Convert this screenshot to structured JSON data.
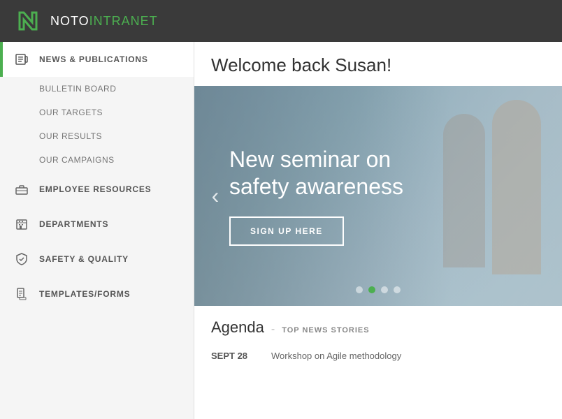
{
  "topbar": {
    "logo_text_part1": "NOTO",
    "logo_text_part2": "INTRANET"
  },
  "sidebar": {
    "items": [
      {
        "id": "news-publications",
        "label": "NEWS & PUBLICATIONS",
        "icon": "newspaper-icon",
        "active": true,
        "subitems": [
          {
            "id": "bulletin-board",
            "label": "BULLETIN BOARD"
          },
          {
            "id": "our-targets",
            "label": "OUR TARGETS"
          },
          {
            "id": "our-results",
            "label": "OUR RESULTS"
          },
          {
            "id": "our-campaigns",
            "label": "OUR CAMPAIGNS"
          }
        ]
      },
      {
        "id": "employee-resources",
        "label": "EMPLOYEE RESOURCES",
        "icon": "briefcase-icon",
        "active": false,
        "subitems": []
      },
      {
        "id": "departments",
        "label": "DEPARTMENTS",
        "icon": "building-icon",
        "active": false,
        "subitems": []
      },
      {
        "id": "safety-quality",
        "label": "SAFETY & QUALITY",
        "icon": "shield-icon",
        "active": false,
        "subitems": []
      },
      {
        "id": "templates-forms",
        "label": "TEMPLATES/FORMS",
        "icon": "file-icon",
        "active": false,
        "subitems": []
      }
    ]
  },
  "content": {
    "welcome_message": "Welcome back Susan!",
    "banner": {
      "title": "New seminar on safety awareness",
      "button_label": "SIGN UP HERE",
      "dots": [
        {
          "id": 1,
          "active": false
        },
        {
          "id": 2,
          "active": true
        },
        {
          "id": 3,
          "active": false
        },
        {
          "id": 4,
          "active": false
        }
      ]
    },
    "agenda": {
      "title": "Agenda",
      "subtitle": "TOP NEWS STORIES",
      "rows": [
        {
          "date": "SEPT 28",
          "description": "Workshop on Agile methodology"
        }
      ]
    }
  }
}
